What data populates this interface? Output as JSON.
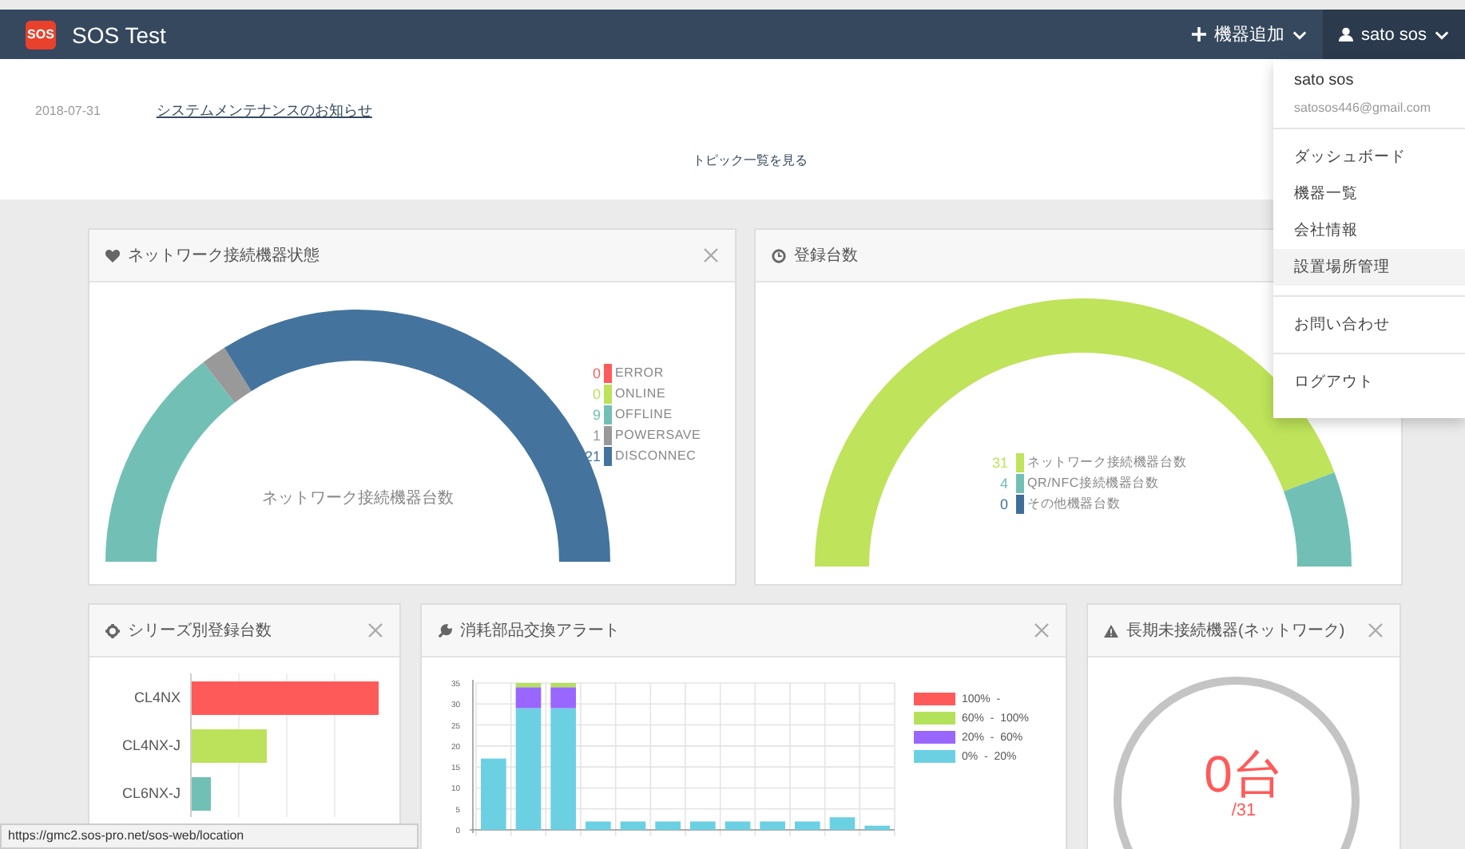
{
  "navbar": {
    "logo": "SOS",
    "title": "SOS Test",
    "items": [
      {
        "kind": "add",
        "label": "機器追加",
        "selected": false
      },
      {
        "kind": "user",
        "label": "sato sos",
        "selected": true
      }
    ]
  },
  "topics": {
    "items": [
      {
        "date": "2018-07-31",
        "title": "システムメンテナンスのお知らせ"
      }
    ],
    "more_link": "トピック一覧を見る"
  },
  "panels": [
    {
      "kind": "network_gauge",
      "title": "ネットワーク接続機器状態",
      "closable": true,
      "center_label": "ネットワーク接続機器台数",
      "legend": [
        {
          "value": "0",
          "label": "ERROR",
          "color": "#ff5a5a"
        },
        {
          "value": "0",
          "label": "ONLINE",
          "color": "#bce15a"
        },
        {
          "value": "9",
          "label": "OFFLINE",
          "color": "#72c0b5"
        },
        {
          "value": "1",
          "label": "POWERSAVE",
          "color": "#999999"
        },
        {
          "value": "21",
          "label": "DISCONNEC",
          "color": "#44749d"
        }
      ]
    },
    {
      "kind": "count_gauge",
      "title": "登録台数",
      "closable": false,
      "legend": [
        {
          "value": "31",
          "label": "ネットワーク接続機器台数",
          "color": "#bfe35a"
        },
        {
          "value": "4",
          "label": "QR/NFC接続機器台数",
          "color": "#72c0b5"
        },
        {
          "value": "0",
          "label": "その他機器台数",
          "color": "#3f6e98"
        }
      ]
    },
    {
      "kind": "series_bars",
      "title": "シリーズ別登録台数",
      "closable": true,
      "bars": [
        {
          "label": "CL4NX",
          "color": "#ff5a5a"
        },
        {
          "label": "CL4NX-J",
          "color": "#bce15a"
        },
        {
          "label": "CL6NX-J",
          "color": "#72c0b5"
        }
      ]
    },
    {
      "kind": "stacked_chart",
      "title": "消耗部品交換アラート",
      "closable": true,
      "chart_data": {
        "type": "bar",
        "stacked": true,
        "grid": true,
        "ylim": [
          0,
          35
        ],
        "yticks": [
          0,
          5,
          10,
          15,
          20,
          25,
          30,
          35
        ],
        "series": [
          {
            "name": "100%  -",
            "color": "#ff5a5a",
            "values": [
              0,
              0,
              0,
              0,
              0,
              0,
              0,
              0,
              0,
              0,
              0,
              0
            ]
          },
          {
            "name": "60%  -  100%",
            "color": "#b4e15a",
            "values": [
              0,
              1,
              1,
              0,
              0,
              0,
              0,
              0,
              0,
              0,
              0,
              0
            ]
          },
          {
            "name": "20%  -  60%",
            "color": "#9966ff",
            "values": [
              0,
              5,
              5,
              0,
              0,
              0,
              0,
              0,
              0,
              0,
              0,
              0
            ]
          },
          {
            "name": "0%  -  20%",
            "color": "#6cd0e3",
            "values": [
              17,
              29,
              29,
              2,
              2,
              2,
              2,
              2,
              2,
              2,
              3,
              1
            ]
          }
        ]
      }
    },
    {
      "kind": "counter",
      "title": "長期未接続機器(ネットワーク)",
      "closable": true,
      "value": "0台",
      "total": "/31"
    }
  ],
  "user_menu": {
    "name": "sato sos",
    "email": "satosos446@gmail.com",
    "groups": [
      {
        "items": [
          {
            "label": "ダッシュボード",
            "selected": false
          },
          {
            "label": "機器一覧",
            "selected": false
          },
          {
            "label": "会社情報",
            "selected": false
          },
          {
            "label": "設置場所管理",
            "selected": true
          }
        ]
      },
      {
        "items": [
          {
            "label": "お問い合わせ",
            "selected": false
          }
        ]
      },
      {
        "items": [
          {
            "label": "ログアウト",
            "selected": false
          }
        ]
      }
    ]
  },
  "status_bar": {
    "url": "https://gmc2.sos-pro.net/sos-web/location"
  }
}
